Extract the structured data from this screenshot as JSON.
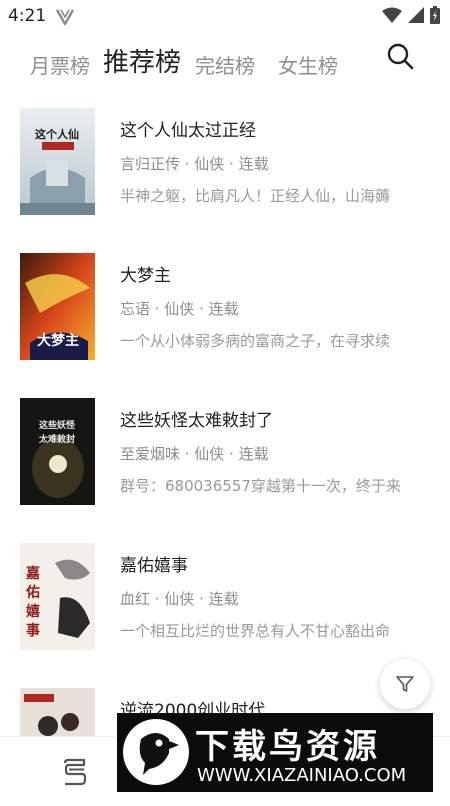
{
  "status_bar": {
    "time": "4:21",
    "app_icon": "v-logo-icon",
    "icons": [
      "wifi-icon",
      "cellular-signal-icon",
      "battery-icon"
    ]
  },
  "tabs": [
    {
      "label": "月票榜",
      "active": false
    },
    {
      "label": "推荐榜",
      "active": true
    },
    {
      "label": "完结榜",
      "active": false
    },
    {
      "label": "女生榜",
      "active": false
    }
  ],
  "search": {
    "icon": "search-icon"
  },
  "books": [
    {
      "title": "这个人仙太过正经",
      "meta": "言归正传 · 仙侠 · 连载",
      "desc": "半神之躯，比肩凡人！正经人仙，山海薅",
      "cover_text": "这个人仙太过正经"
    },
    {
      "title": "大梦主",
      "meta": "忘语 · 仙侠 · 连载",
      "desc": "一个从小体弱多病的富商之子，在寻求续",
      "cover_text": "大梦主"
    },
    {
      "title": "这些妖怪太难敕封了",
      "meta": "至爱烟味 · 仙侠 · 连载",
      "desc": "群号：680036557穿越第十一次，终于来",
      "cover_text": "这些妖怪太难敕封了"
    },
    {
      "title": "嘉佑嬉事",
      "meta": "血红 · 仙侠 · 连载",
      "desc": "一个相互比烂的世界总有人不甘心豁出命",
      "cover_text": "嘉佑嬉事"
    },
    {
      "title": "逆流2000创业时代",
      "meta": "",
      "desc": "",
      "cover_text": ""
    }
  ],
  "filter": {
    "icon": "filter-icon"
  },
  "bottom_bar": {
    "icon": "bookshelf-icon"
  },
  "watermark": {
    "title": "下载鸟资源",
    "url": "WWW.XIAZAINIAO.COM"
  },
  "colors": {
    "active_tab": "#222222",
    "inactive_tab": "#8f8f8f",
    "meta_text": "#8e8e8e",
    "watermark_bg": "#0b0b0b"
  }
}
